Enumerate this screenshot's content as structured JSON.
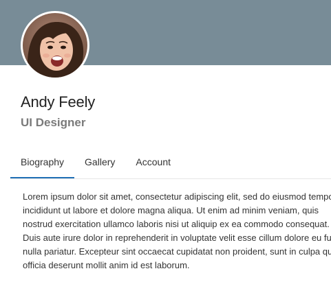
{
  "profile": {
    "name": "Andy Feely",
    "role": "UI Designer"
  },
  "tabs": [
    {
      "label": "Biography",
      "active": true
    },
    {
      "label": "Gallery",
      "active": false
    },
    {
      "label": "Account",
      "active": false
    }
  ],
  "biography": {
    "text": "Lorem ipsum dolor sit amet, consectetur adipiscing elit, sed do eiusmod tempor incididunt ut labore et dolore magna aliqua. Ut enim ad minim veniam, quis nostrud exercitation ullamco laboris nisi ut aliquip ex ea commodo consequat. Duis aute irure dolor in reprehenderit in voluptate velit esse cillum dolore eu fugiat nulla pariatur. Excepteur sint occaecat cupidatat non proident, sunt in culpa qui officia deserunt mollit anim id est laborum."
  },
  "colors": {
    "cover": "#788c97",
    "active_tab_underline": "#1f6fb5",
    "role_text": "#7a7a7a"
  },
  "icons": {
    "avatar": "profile-photo"
  }
}
